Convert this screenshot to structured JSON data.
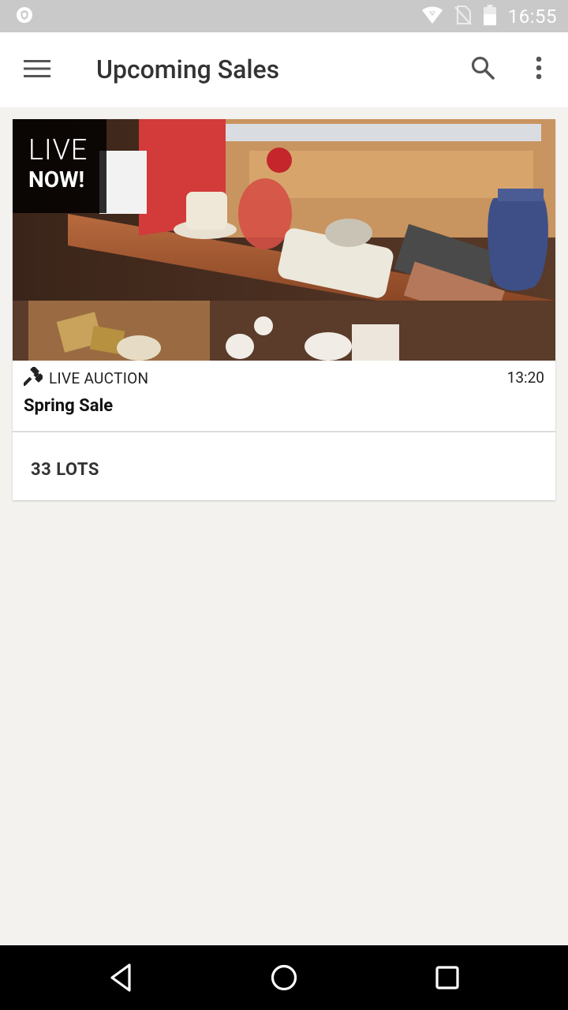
{
  "status_bar": {
    "time": "16:55",
    "icons": [
      "shield-icon",
      "wifi-icon",
      "no-sim-icon",
      "battery-icon"
    ]
  },
  "app_bar": {
    "title": "Upcoming Sales",
    "icons": [
      "menu-icon",
      "search-icon",
      "more-vert-icon"
    ]
  },
  "sale": {
    "badge_line1": "LIVE",
    "badge_line2": "NOW!",
    "type_icon": "gavel-icon",
    "type": "LIVE AUCTION",
    "time": "13:20",
    "name": "Spring Sale",
    "lots": "33 LOTS"
  },
  "nav_bar": {
    "icons": [
      "back-icon",
      "home-icon",
      "recents-icon"
    ]
  },
  "colors": {
    "status_bar": "#c9c9c9",
    "app_bar": "#ffffff",
    "background": "#f3f2ef",
    "badge": "#000000",
    "nav_bar": "#000000"
  }
}
